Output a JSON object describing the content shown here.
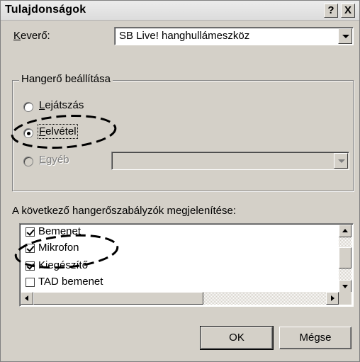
{
  "window": {
    "title": "Tulajdonságok",
    "help_button": "?",
    "close_button": "X"
  },
  "mixer": {
    "label_underlined": "K",
    "label_rest": "everő:",
    "selected_device": "SB Live! hanghullámeszköz"
  },
  "volume_group": {
    "legend": "Hangerő beállítása",
    "options": [
      {
        "underlined": "L",
        "rest": "ejátszás",
        "checked": false,
        "enabled": true
      },
      {
        "underlined": "F",
        "rest": "elvétel",
        "checked": true,
        "enabled": true
      },
      {
        "underlined": "E",
        "rest": "gyéb",
        "checked": false,
        "enabled": false
      }
    ],
    "other_combo_value": ""
  },
  "controls_list": {
    "heading": "A következő hangerőszabályzók megjelenítése:",
    "items": [
      {
        "label": "Bemenet",
        "checked": true
      },
      {
        "label": "Mikrofon",
        "checked": true
      },
      {
        "label": "Kiegészítő",
        "checked": true
      },
      {
        "label": "TAD bemenet",
        "checked": false
      }
    ]
  },
  "buttons": {
    "ok": "OK",
    "cancel": "Mégse"
  },
  "icons": [
    "combo-dropdown-arrow-icon",
    "scroll-up-arrow-icon",
    "scroll-down-arrow-icon",
    "scroll-left-arrow-icon",
    "scroll-right-arrow-icon",
    "checkmark-icon"
  ],
  "colors": {
    "dialog_face": "#d4d0c8",
    "annotation": "#000000"
  }
}
